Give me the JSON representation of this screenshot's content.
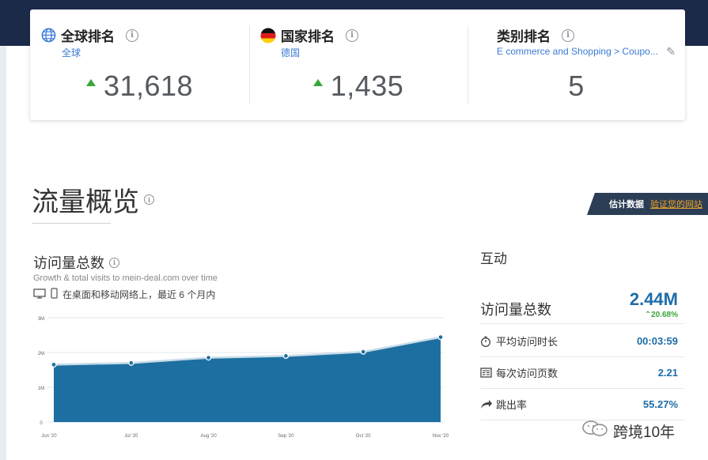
{
  "ranks": [
    {
      "title": "全球排名",
      "sub": "全球",
      "value": "31,618",
      "icon": "globe-icon",
      "trend": "up"
    },
    {
      "title": "国家排名",
      "sub": "德国",
      "value": "1,435",
      "icon": "germany-flag-icon",
      "trend": "up"
    },
    {
      "title": "类别排名",
      "sub": "E commerce and Shopping > Coupo...",
      "value": "5",
      "icon": "",
      "trend": "none"
    }
  ],
  "overview": {
    "title": "流量概览"
  },
  "estimate": {
    "label": "估计数据",
    "link": "验证您的网站"
  },
  "visits": {
    "title": "访问量总数",
    "subtitle": "Growth & total visits to mein-deal.com over time",
    "device_text": "在桌面和移动网络上，最近 6 个月内"
  },
  "chart_data": {
    "type": "area",
    "categories": [
      "Jun '20",
      "Jul '20",
      "Aug '20",
      "Sep '20",
      "Oct '20",
      "Nov '20"
    ],
    "values": [
      1.65,
      1.7,
      1.85,
      1.9,
      2.02,
      2.44
    ],
    "y_ticks": [
      "3M",
      "2M",
      "1M",
      "0"
    ],
    "ylim": [
      0,
      3
    ],
    "grid": true,
    "colors": {
      "fill": "#1e6fa1",
      "line": "#c8dce9",
      "point": "#1e6fa1"
    }
  },
  "interaction": {
    "title": "互动",
    "total": {
      "label": "访问量总数",
      "value": "2.44M",
      "delta": "20.68%"
    },
    "rows": [
      {
        "label": "平均访问时长",
        "value": "00:03:59",
        "icon": "timer-icon"
      },
      {
        "label": "每次访问页数",
        "value": "2.21",
        "icon": "pages-icon"
      },
      {
        "label": "跳出率",
        "value": "55.27%",
        "icon": "bounce-arrow-icon"
      }
    ]
  },
  "watermark": {
    "text": "跨境10年"
  },
  "colors": {
    "accent": "#1d6da8",
    "up": "#3aa53a",
    "link": "#3a7bd5",
    "header": "#1c2a4a"
  }
}
